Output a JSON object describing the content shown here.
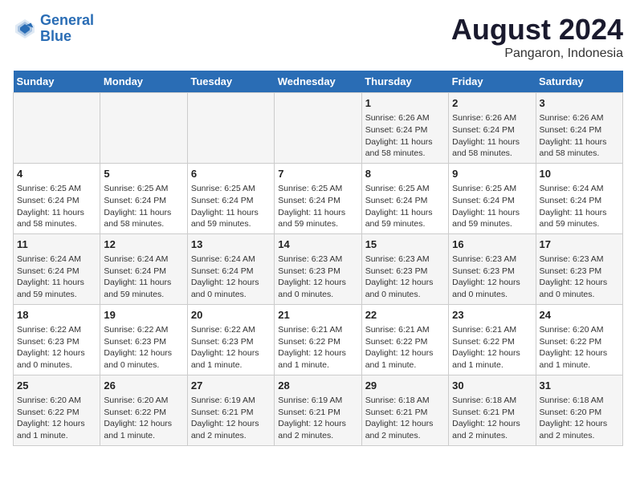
{
  "logo": {
    "line1": "General",
    "line2": "Blue"
  },
  "title": "August 2024",
  "subtitle": "Pangaron, Indonesia",
  "days_of_week": [
    "Sunday",
    "Monday",
    "Tuesday",
    "Wednesday",
    "Thursday",
    "Friday",
    "Saturday"
  ],
  "weeks": [
    [
      {
        "day": "",
        "info": ""
      },
      {
        "day": "",
        "info": ""
      },
      {
        "day": "",
        "info": ""
      },
      {
        "day": "",
        "info": ""
      },
      {
        "day": "1",
        "info": "Sunrise: 6:26 AM\nSunset: 6:24 PM\nDaylight: 11 hours\nand 58 minutes."
      },
      {
        "day": "2",
        "info": "Sunrise: 6:26 AM\nSunset: 6:24 PM\nDaylight: 11 hours\nand 58 minutes."
      },
      {
        "day": "3",
        "info": "Sunrise: 6:26 AM\nSunset: 6:24 PM\nDaylight: 11 hours\nand 58 minutes."
      }
    ],
    [
      {
        "day": "4",
        "info": "Sunrise: 6:25 AM\nSunset: 6:24 PM\nDaylight: 11 hours\nand 58 minutes."
      },
      {
        "day": "5",
        "info": "Sunrise: 6:25 AM\nSunset: 6:24 PM\nDaylight: 11 hours\nand 58 minutes."
      },
      {
        "day": "6",
        "info": "Sunrise: 6:25 AM\nSunset: 6:24 PM\nDaylight: 11 hours\nand 59 minutes."
      },
      {
        "day": "7",
        "info": "Sunrise: 6:25 AM\nSunset: 6:24 PM\nDaylight: 11 hours\nand 59 minutes."
      },
      {
        "day": "8",
        "info": "Sunrise: 6:25 AM\nSunset: 6:24 PM\nDaylight: 11 hours\nand 59 minutes."
      },
      {
        "day": "9",
        "info": "Sunrise: 6:25 AM\nSunset: 6:24 PM\nDaylight: 11 hours\nand 59 minutes."
      },
      {
        "day": "10",
        "info": "Sunrise: 6:24 AM\nSunset: 6:24 PM\nDaylight: 11 hours\nand 59 minutes."
      }
    ],
    [
      {
        "day": "11",
        "info": "Sunrise: 6:24 AM\nSunset: 6:24 PM\nDaylight: 11 hours\nand 59 minutes."
      },
      {
        "day": "12",
        "info": "Sunrise: 6:24 AM\nSunset: 6:24 PM\nDaylight: 11 hours\nand 59 minutes."
      },
      {
        "day": "13",
        "info": "Sunrise: 6:24 AM\nSunset: 6:24 PM\nDaylight: 12 hours\nand 0 minutes."
      },
      {
        "day": "14",
        "info": "Sunrise: 6:23 AM\nSunset: 6:23 PM\nDaylight: 12 hours\nand 0 minutes."
      },
      {
        "day": "15",
        "info": "Sunrise: 6:23 AM\nSunset: 6:23 PM\nDaylight: 12 hours\nand 0 minutes."
      },
      {
        "day": "16",
        "info": "Sunrise: 6:23 AM\nSunset: 6:23 PM\nDaylight: 12 hours\nand 0 minutes."
      },
      {
        "day": "17",
        "info": "Sunrise: 6:23 AM\nSunset: 6:23 PM\nDaylight: 12 hours\nand 0 minutes."
      }
    ],
    [
      {
        "day": "18",
        "info": "Sunrise: 6:22 AM\nSunset: 6:23 PM\nDaylight: 12 hours\nand 0 minutes."
      },
      {
        "day": "19",
        "info": "Sunrise: 6:22 AM\nSunset: 6:23 PM\nDaylight: 12 hours\nand 0 minutes."
      },
      {
        "day": "20",
        "info": "Sunrise: 6:22 AM\nSunset: 6:23 PM\nDaylight: 12 hours\nand 1 minute."
      },
      {
        "day": "21",
        "info": "Sunrise: 6:21 AM\nSunset: 6:22 PM\nDaylight: 12 hours\nand 1 minute."
      },
      {
        "day": "22",
        "info": "Sunrise: 6:21 AM\nSunset: 6:22 PM\nDaylight: 12 hours\nand 1 minute."
      },
      {
        "day": "23",
        "info": "Sunrise: 6:21 AM\nSunset: 6:22 PM\nDaylight: 12 hours\nand 1 minute."
      },
      {
        "day": "24",
        "info": "Sunrise: 6:20 AM\nSunset: 6:22 PM\nDaylight: 12 hours\nand 1 minute."
      }
    ],
    [
      {
        "day": "25",
        "info": "Sunrise: 6:20 AM\nSunset: 6:22 PM\nDaylight: 12 hours\nand 1 minute."
      },
      {
        "day": "26",
        "info": "Sunrise: 6:20 AM\nSunset: 6:22 PM\nDaylight: 12 hours\nand 1 minute."
      },
      {
        "day": "27",
        "info": "Sunrise: 6:19 AM\nSunset: 6:21 PM\nDaylight: 12 hours\nand 2 minutes."
      },
      {
        "day": "28",
        "info": "Sunrise: 6:19 AM\nSunset: 6:21 PM\nDaylight: 12 hours\nand 2 minutes."
      },
      {
        "day": "29",
        "info": "Sunrise: 6:18 AM\nSunset: 6:21 PM\nDaylight: 12 hours\nand 2 minutes."
      },
      {
        "day": "30",
        "info": "Sunrise: 6:18 AM\nSunset: 6:21 PM\nDaylight: 12 hours\nand 2 minutes."
      },
      {
        "day": "31",
        "info": "Sunrise: 6:18 AM\nSunset: 6:20 PM\nDaylight: 12 hours\nand 2 minutes."
      }
    ]
  ]
}
